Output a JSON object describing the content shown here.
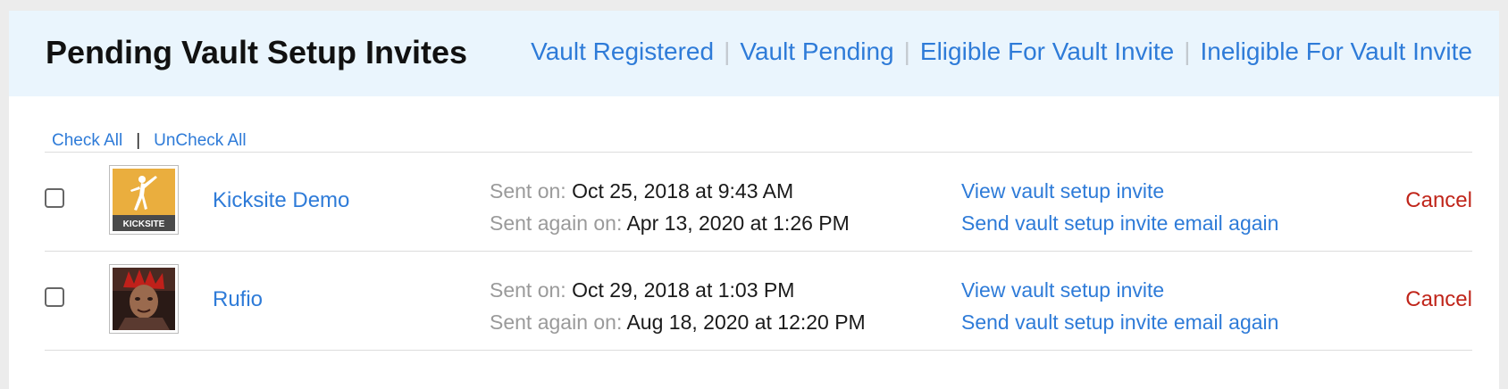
{
  "header": {
    "title": "Pending Vault Setup Invites",
    "filters": [
      "Vault Registered",
      "Vault Pending",
      "Eligible For Vault Invite",
      "Ineligible For Vault Invite"
    ]
  },
  "bulk": {
    "check_all": "Check All",
    "separator": "|",
    "uncheck_all": "UnCheck All"
  },
  "labels": {
    "sent_on": "Sent on:",
    "sent_again_on": "Sent again on:",
    "view_invite": "View vault setup invite",
    "resend_invite": "Send vault setup invite email again",
    "cancel": "Cancel"
  },
  "invites": [
    {
      "name": "Kicksite Demo",
      "avatar_icon": "kicksite-logo-icon",
      "avatar_text": "KICKSITE",
      "sent_on": "Oct 25, 2018 at 9:43 AM",
      "sent_again_on": "Apr 13, 2020 at 1:26 PM",
      "checked": false
    },
    {
      "name": "Rufio",
      "avatar_icon": "user-photo-icon",
      "sent_on": "Oct 29, 2018 at 1:03 PM",
      "sent_again_on": "Aug 18, 2020 at 12:20 PM",
      "checked": false
    }
  ],
  "colors": {
    "link": "#2e7bd8",
    "cancel": "#c0251a",
    "header_bg": "#eaf5fd",
    "kicksite_brand": "#eaae3e"
  }
}
